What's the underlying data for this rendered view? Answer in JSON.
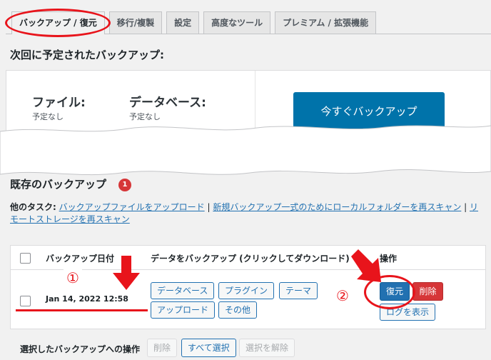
{
  "tabs": [
    {
      "label": "バックアップ / 復元",
      "active": true
    },
    {
      "label": "移行/複製",
      "active": false
    },
    {
      "label": "設定",
      "active": false
    },
    {
      "label": "高度なツール",
      "active": false
    },
    {
      "label": "プレミアム / 拡張機能",
      "active": false
    }
  ],
  "scheduled": {
    "heading": "次回に予定されたバックアップ:",
    "files_label": "ファイル:",
    "files_value": "予定なし",
    "db_label": "データベース:",
    "db_value": "予定なし",
    "backup_now": "今すぐバックアップ"
  },
  "existing": {
    "heading": "既存のバックアップ",
    "count": "1"
  },
  "tasks": {
    "label": "他のタスク:",
    "link_upload": "バックアップファイルをアップロード",
    "sep1": " | ",
    "link_rescan_local": "新規バックアップ一式のためにローカルフォルダーを再スキャン",
    "sep2": " | ",
    "link_rescan_remote": "リモートストレージを再スキャン"
  },
  "table": {
    "col_date": "バックアップ日付",
    "col_data": "データをバックアップ (クリックしてダウンロード)",
    "col_actions": "操作",
    "rows": [
      {
        "date": "Jan 14, 2022 12:58",
        "downloads": [
          "データベース",
          "プラグイン",
          "テーマ",
          "アップロード",
          "その他"
        ],
        "restore": "復元",
        "delete": "削除",
        "view_log": "ログを表示"
      }
    ]
  },
  "bulk": {
    "label": "選択したバックアップへの操作",
    "delete": "削除",
    "select_all": "すべて選択",
    "deselect": "選択を解除"
  },
  "annotations": {
    "step1": "①",
    "step2": "②"
  },
  "colors": {
    "primary": "#0073aa",
    "link": "#2271b1",
    "danger": "#d63638",
    "annotation_red": "#e8141b"
  }
}
